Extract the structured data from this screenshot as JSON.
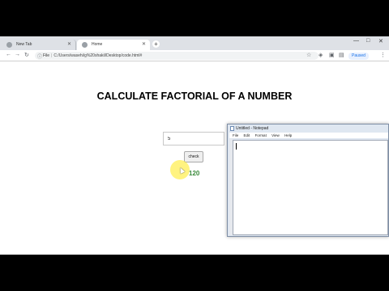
{
  "browser": {
    "tabs": [
      {
        "label": "New Tab",
        "active": false
      },
      {
        "label": "Home",
        "active": true
      }
    ],
    "newtab_symbol": "+",
    "window_controls": [
      "—",
      "□",
      "✕"
    ],
    "address": {
      "info_symbol": "ⓘ",
      "scheme": "File",
      "separator": "|",
      "url": "C:/Users/wasehi/g%20shakil/Desktop/code.html#"
    },
    "paused_label": "Paused"
  },
  "page": {
    "title": "CALCULATE FACTORIAL OF A NUMBER",
    "input_value": "5",
    "button_label": "check",
    "result": "120"
  },
  "notepad": {
    "title": "Untitled - Notepad",
    "menu": [
      "File",
      "Edit",
      "Format",
      "View",
      "Help"
    ],
    "content": ""
  }
}
